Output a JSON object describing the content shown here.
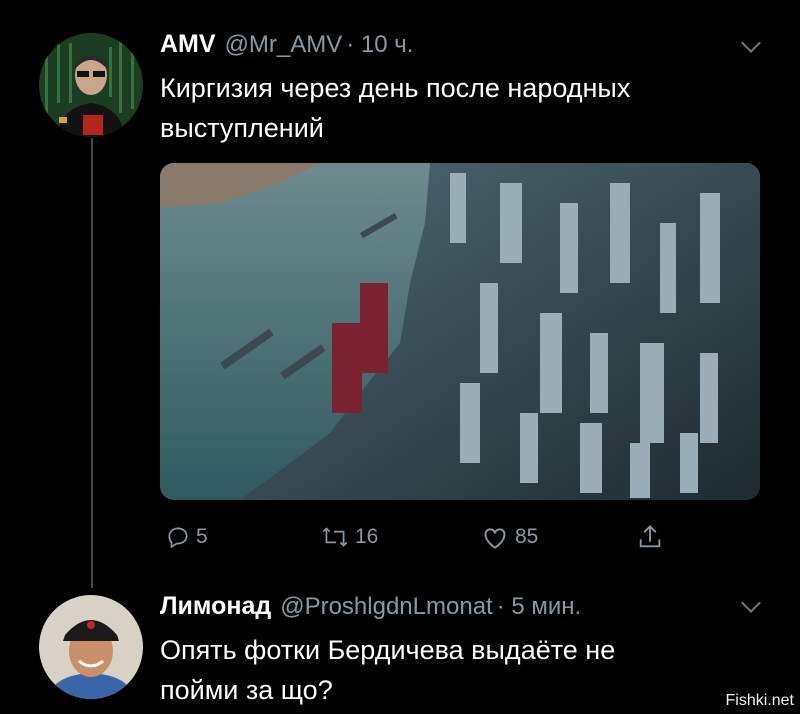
{
  "tweet1": {
    "name": "AMV",
    "handle": "@Mr_AMV",
    "time": "· 10 ч.",
    "text_line1": "Киргизия через день после народных",
    "text_line2": "выступлений",
    "actions": {
      "replies": "5",
      "retweets": "16",
      "likes": "85"
    }
  },
  "tweet2": {
    "name": "Лимонад",
    "handle": "@ProshlgdnLmonat",
    "time": "· 5 мин.",
    "text_line1": "Опять фотки Бердичева выдаёте не",
    "text_line2": "пойми за що?"
  },
  "watermark": "Fishki.net",
  "colors": {
    "background": "#000000",
    "secondary_text": "#8899a6",
    "thread_line": "#3d4a55"
  },
  "icons": [
    "reply-icon",
    "retweet-icon",
    "like-icon",
    "share-icon",
    "chevron-down-icon"
  ]
}
